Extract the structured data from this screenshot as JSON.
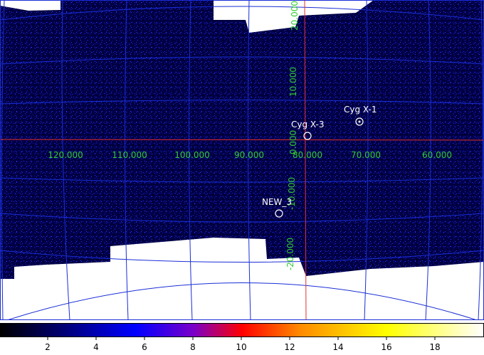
{
  "map": {
    "background_color": "#ffffff",
    "grid_color": "#1a2ed6",
    "axis_color": "#e23030",
    "label_color": "#33cc33",
    "source_color": "#ffffff",
    "longitude_labels": [
      "120.000",
      "110.000",
      "100.000",
      "90.000",
      "80.000",
      "70.000",
      "60.000"
    ],
    "latitude_labels": [
      "20.000",
      "10.000",
      "0.000",
      "-10.000",
      "-20.000"
    ],
    "sources": [
      {
        "name": "Cyg X-1",
        "style": "dot"
      },
      {
        "name": "Cyg X-3",
        "style": "open"
      },
      {
        "name": "NEW_3",
        "style": "open"
      }
    ]
  },
  "colorbar": {
    "ticks": [
      "2",
      "4",
      "6",
      "8",
      "10",
      "12",
      "14",
      "16",
      "18"
    ],
    "colormap": [
      "#000000",
      "#00006b",
      "#0000ff",
      "#7a00c8",
      "#ff0000",
      "#ff8a00",
      "#ffff00",
      "#ffffff"
    ]
  }
}
